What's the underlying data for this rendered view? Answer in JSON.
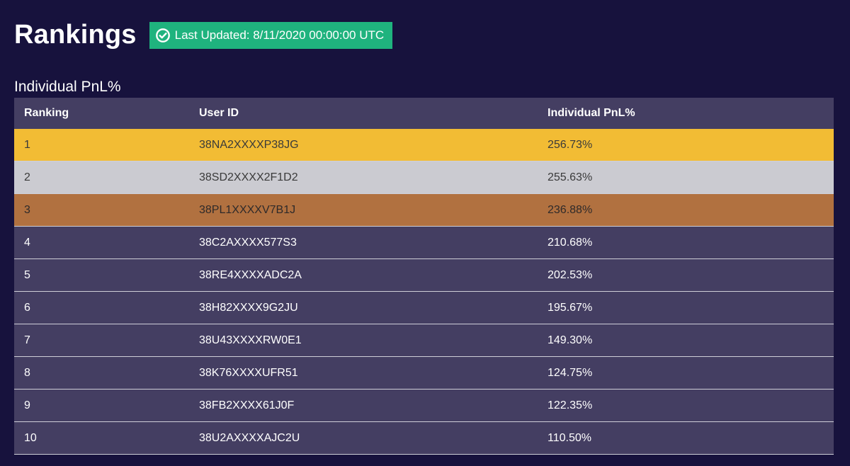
{
  "page": {
    "title": "Rankings",
    "badge_text": "Last Updated: 8/11/2020 00:00:00 UTC",
    "badge_icon": "check-circle-icon",
    "accent_green": "#1fb37e",
    "background": "#17123d"
  },
  "section": {
    "title": "Individual PnL%"
  },
  "table": {
    "columns": [
      "Ranking",
      "User ID",
      "Individual PnL%"
    ],
    "rows": [
      {
        "rank": "1",
        "user_id": "38NA2XXXXP38JG",
        "pnl": "256.73%"
      },
      {
        "rank": "2",
        "user_id": "38SD2XXXX2F1D2",
        "pnl": "255.63%"
      },
      {
        "rank": "3",
        "user_id": "38PL1XXXXV7B1J",
        "pnl": "236.88%"
      },
      {
        "rank": "4",
        "user_id": "38C2AXXXX577S3",
        "pnl": "210.68%"
      },
      {
        "rank": "5",
        "user_id": "38RE4XXXXADC2A",
        "pnl": "202.53%"
      },
      {
        "rank": "6",
        "user_id": "38H82XXXX9G2JU",
        "pnl": "195.67%"
      },
      {
        "rank": "7",
        "user_id": "38U43XXXXRW0E1",
        "pnl": "149.30%"
      },
      {
        "rank": "8",
        "user_id": "38K76XXXXUFR51",
        "pnl": "124.75%"
      },
      {
        "rank": "9",
        "user_id": "38FB2XXXX61J0F",
        "pnl": "122.35%"
      },
      {
        "rank": "10",
        "user_id": "38U2AXXXXAJC2U",
        "pnl": "110.50%"
      }
    ],
    "row_colors": {
      "gold": "#f2bc34",
      "silver": "#cbcbd1",
      "bronze": "#b17140",
      "default": "#443e62"
    }
  }
}
